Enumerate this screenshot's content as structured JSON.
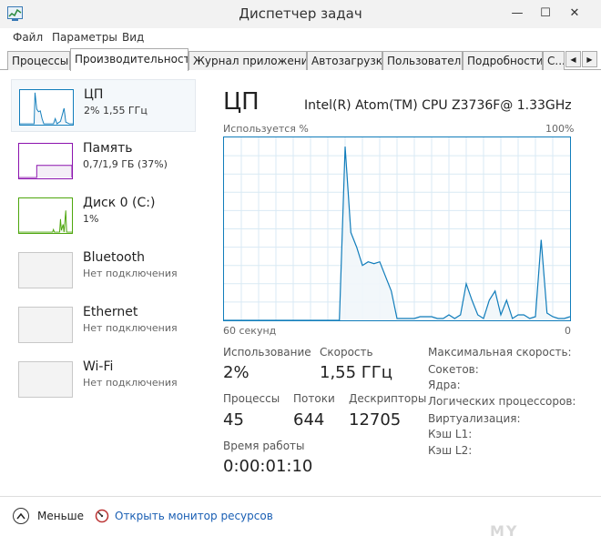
{
  "window": {
    "title": "Диспетчер задач",
    "minimize_glyph": "—",
    "maximize_glyph": "☐",
    "close_glyph": "✕"
  },
  "menu": [
    "Файл",
    "Параметры",
    "Вид"
  ],
  "tabs": [
    {
      "label": "Процессы",
      "active": false
    },
    {
      "label": "Производительность",
      "active": true
    },
    {
      "label": "Журнал приложений",
      "active": false
    },
    {
      "label": "Автозагрузка",
      "active": false
    },
    {
      "label": "Пользователи",
      "active": false
    },
    {
      "label": "Подробности",
      "active": false
    },
    {
      "label": "С...",
      "active": false
    }
  ],
  "tab_scroll": {
    "left_glyph": "◀",
    "right_glyph": "▶"
  },
  "sidebar": [
    {
      "name": "ЦП",
      "sub": "2% 1,55 ГГц",
      "color": "#117dbb"
    },
    {
      "name": "Память",
      "sub": "0,7/1,9 ГБ (37%)",
      "color": "#8b12ae"
    },
    {
      "name": "Диск 0 (C:)",
      "sub": "1%",
      "color": "#4da60c"
    },
    {
      "name": "Bluetooth",
      "sub": "Нет подключения",
      "color": "#c8c8c8"
    },
    {
      "name": "Ethernet",
      "sub": "Нет подключения",
      "color": "#c8c8c8"
    },
    {
      "name": "Wi-Fi",
      "sub": "Нет подключения",
      "color": "#c8c8c8"
    }
  ],
  "main": {
    "title": "ЦП",
    "cpu_model": "Intel(R) Atom(TM) CPU Z3736F@ 1.33GHz",
    "graph_top_left": "Используется %",
    "graph_top_right": "100%",
    "graph_bottom_left": "60 секунд",
    "graph_bottom_right": "0",
    "usage_label": "Использование",
    "usage_value": "2%",
    "speed_label": "Скорость",
    "speed_value": "1,55 ГГц",
    "processes_label": "Процессы",
    "processes_value": "45",
    "threads_label": "Потоки",
    "threads_value": "644",
    "handles_label": "Дескрипторы",
    "handles_value": "12705",
    "uptime_label": "Время работы",
    "uptime_value": "0:00:01:10",
    "specs": [
      "Максимальная скорость:",
      "Сокетов:",
      "Ядра:",
      "Логических процессоров:",
      "Виртуализация:",
      "Кэш L1:",
      "Кэш L2:"
    ]
  },
  "footer": {
    "less_label": "Меньше",
    "monitor_link": "Открыть монитор ресурсов"
  },
  "watermark": "MY",
  "chart_data": {
    "type": "area",
    "ylim": [
      0,
      100
    ],
    "xlim": [
      60,
      0
    ],
    "color": "#117dbb",
    "fill": "#f1f6fa",
    "x": [
      60,
      40,
      39,
      38,
      37,
      36,
      35,
      34,
      33,
      31,
      30,
      29,
      28,
      27,
      26,
      25,
      24,
      23,
      22,
      21,
      20,
      19,
      18,
      17,
      16,
      15,
      14,
      13,
      12,
      11,
      10,
      9,
      8,
      7,
      6,
      5,
      4,
      3,
      2,
      1,
      0
    ],
    "y": [
      0,
      0,
      95,
      48,
      40,
      30,
      32,
      31,
      32,
      16,
      1,
      1,
      1,
      1,
      2,
      2,
      2,
      1,
      1,
      3,
      1,
      3,
      20,
      11,
      3,
      1,
      11,
      16,
      3,
      11,
      1,
      3,
      3,
      1,
      2,
      44,
      4,
      2,
      1,
      1,
      2
    ]
  }
}
